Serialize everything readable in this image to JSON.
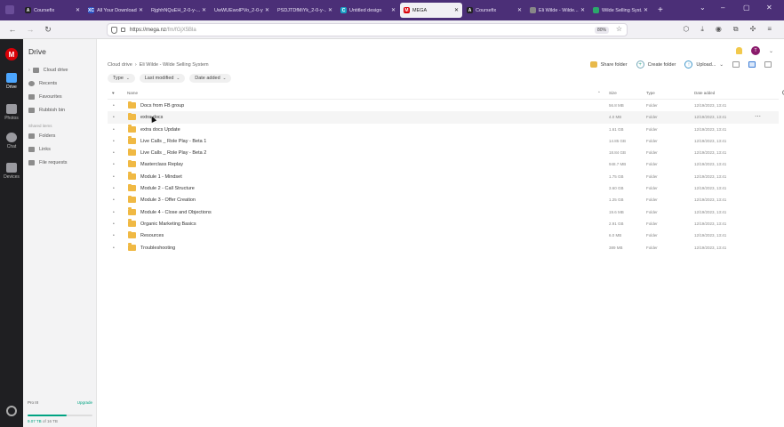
{
  "browser": {
    "tabs": [
      {
        "label": "Coursefix",
        "icon": "coursefix-icon",
        "color": "#222222",
        "glyph": "A"
      },
      {
        "label": "All Your Downloads",
        "icon": "xc-icon",
        "color": "#2a55c8",
        "glyph": "XC"
      },
      {
        "label": "RjghhNQuEH_2-0-y-...",
        "icon": "close-icon",
        "color": "",
        "glyph": ""
      },
      {
        "label": "UwWUEwolPVo_2-0-y-...",
        "icon": "close-icon",
        "color": "",
        "glyph": ""
      },
      {
        "label": "PSDJTDfMiYk_2-0-y-...",
        "icon": "close-icon",
        "color": "",
        "glyph": ""
      },
      {
        "label": "Untitled design",
        "icon": "canva-icon",
        "color": "#1aa4c7",
        "glyph": "C"
      },
      {
        "label": "MEGA",
        "icon": "mega-icon",
        "color": "#d90007",
        "glyph": "M"
      },
      {
        "label": "Coursefix",
        "icon": "coursefix-icon",
        "color": "#222222",
        "glyph": "A"
      },
      {
        "label": "Eli Wilde - Wilde...",
        "icon": "globe-icon",
        "color": "#888888",
        "glyph": ""
      },
      {
        "label": "Wilde Selling Syst...",
        "icon": "site-icon",
        "color": "#2ba86b",
        "glyph": ""
      }
    ],
    "active_tab": 6,
    "url_host": "https://mega.nz",
    "url_path": "/fm/fGjX5Bla",
    "zoom": "80%"
  },
  "rail": {
    "items": [
      {
        "label": "Drive"
      },
      {
        "label": "Photos"
      },
      {
        "label": "Chat"
      },
      {
        "label": "Devices"
      }
    ]
  },
  "sidebar": {
    "title": "Drive",
    "items": [
      {
        "label": "Cloud drive"
      },
      {
        "label": "Recents"
      },
      {
        "label": "Favourites"
      },
      {
        "label": "Rubbish bin"
      }
    ],
    "section_label": "Shared items",
    "shared": [
      {
        "label": "Folders"
      },
      {
        "label": "Links"
      },
      {
        "label": "File requests"
      }
    ],
    "storage": {
      "plan": "Pro III",
      "upgrade": "Upgrade",
      "used": "9.07 TB",
      "total": "of 16 TB"
    }
  },
  "main": {
    "avatar_initial": "T",
    "breadcrumb": [
      "Cloud drive",
      "Eli Wilde - Wilde Selling System"
    ],
    "actions": {
      "share": "Share folder",
      "create": "Create folder",
      "upload": "Upload..."
    },
    "filters": [
      "Type",
      "Last modified",
      "Date added"
    ],
    "columns": {
      "name": "Name",
      "size": "Size",
      "type": "Type",
      "date": "Date added"
    },
    "rows": [
      {
        "name": "Docs from FB group",
        "size": "56.8 MB",
        "type": "Folder",
        "date": "12/19/2023, 13:41"
      },
      {
        "name": "extra docs",
        "size": "4.0 MB",
        "type": "Folder",
        "date": "12/19/2023, 13:41"
      },
      {
        "name": "extra docs Update",
        "size": "1.61 GB",
        "type": "Folder",
        "date": "12/19/2023, 13:41"
      },
      {
        "name": "Live Calls _ Role Play - Beta 1",
        "size": "14.85 GB",
        "type": "Folder",
        "date": "12/19/2023, 13:41"
      },
      {
        "name": "Live Calls _ Role Play - Beta 2",
        "size": "18.84 GB",
        "type": "Folder",
        "date": "12/19/2023, 13:41"
      },
      {
        "name": "Masterclass Replay",
        "size": "948.7 MB",
        "type": "Folder",
        "date": "12/19/2023, 13:41"
      },
      {
        "name": "Module 1 - Mindset",
        "size": "1.75 GB",
        "type": "Folder",
        "date": "12/19/2023, 13:41"
      },
      {
        "name": "Module 2 - Call Structure",
        "size": "3.60 GB",
        "type": "Folder",
        "date": "12/19/2023, 13:41"
      },
      {
        "name": "Module 3 - Offer Creation",
        "size": "1.25 GB",
        "type": "Folder",
        "date": "12/19/2023, 13:41"
      },
      {
        "name": "Module 4 - Close and Objections",
        "size": "19.6 MB",
        "type": "Folder",
        "date": "12/19/2023, 13:41"
      },
      {
        "name": "Organic Marketing Basics",
        "size": "2.91 GB",
        "type": "Folder",
        "date": "12/19/2023, 13:41"
      },
      {
        "name": "Resources",
        "size": "6.0 MB",
        "type": "Folder",
        "date": "12/19/2023, 13:41"
      },
      {
        "name": "Troubleshooting",
        "size": "389 MB",
        "type": "Folder",
        "date": "12/19/2023, 13:41"
      }
    ],
    "hover_row": 1
  }
}
